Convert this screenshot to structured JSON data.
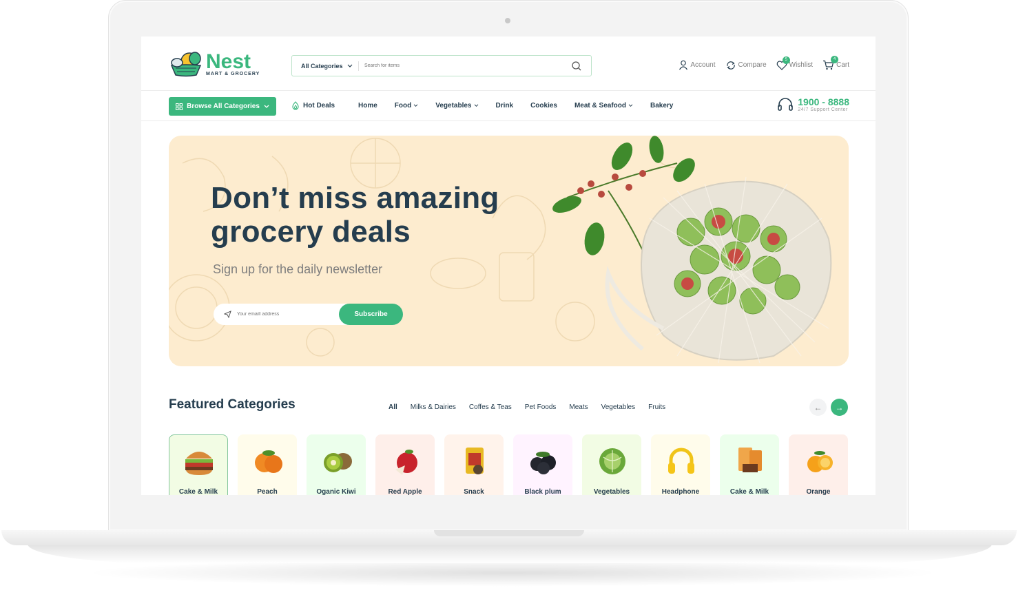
{
  "header": {
    "logo_name": "Nest",
    "logo_tagline": "MART & GROCERY",
    "search_category": "All Categories",
    "search_placeholder": "Search for items",
    "actions": [
      {
        "label": "Account",
        "icon": "user-icon"
      },
      {
        "label": "Compare",
        "icon": "compare-icon"
      },
      {
        "label": "Wishlist",
        "icon": "heart-icon",
        "badge": "5"
      },
      {
        "label": "Cart",
        "icon": "cart-icon",
        "badge": "4"
      }
    ]
  },
  "nav": {
    "browse_label": "Browse All Categories",
    "hot_deals": "Hot Deals",
    "menu": [
      {
        "label": "Home",
        "dropdown": false
      },
      {
        "label": "Food",
        "dropdown": true
      },
      {
        "label": "Vegetables",
        "dropdown": true
      },
      {
        "label": "Drink",
        "dropdown": false
      },
      {
        "label": "Cookies",
        "dropdown": false
      },
      {
        "label": "Meat & Seafood",
        "dropdown": true
      },
      {
        "label": "Bakery",
        "dropdown": false
      }
    ],
    "support_number": "1900 - 8888",
    "support_label": "24/7 Support Center"
  },
  "hero": {
    "title_line1": "Don’t miss amazing",
    "title_line2": "grocery deals",
    "subtitle": "Sign up for the daily newsletter",
    "email_placeholder": "Your emaill address",
    "subscribe_label": "Subscribe"
  },
  "featured": {
    "title": "Featured Categories",
    "tabs": [
      "All",
      "Milks & Dairies",
      "Coffes & Teas",
      "Pet Foods",
      "Meats",
      "Vegetables",
      "Fruits"
    ],
    "prev_arrow": "←",
    "next_arrow": "→",
    "categories": [
      {
        "label": "Cake & Milk",
        "bg": "#f2fce4"
      },
      {
        "label": "Peach",
        "bg": "#fffceb"
      },
      {
        "label": "Oganic Kiwi",
        "bg": "#ecffec"
      },
      {
        "label": "Red Apple",
        "bg": "#feefea"
      },
      {
        "label": "Snack",
        "bg": "#fff3eb"
      },
      {
        "label": "Black plum",
        "bg": "#fff3ff"
      },
      {
        "label": "Vegetables",
        "bg": "#f2fce4"
      },
      {
        "label": "Headphone",
        "bg": "#fffceb"
      },
      {
        "label": "Cake & Milk",
        "bg": "#ecffec"
      },
      {
        "label": "Orange",
        "bg": "#feefea"
      }
    ]
  },
  "colors": {
    "brand": "#3bb77e",
    "heading": "#253d4e",
    "hero_bg": "#fdeccf"
  }
}
